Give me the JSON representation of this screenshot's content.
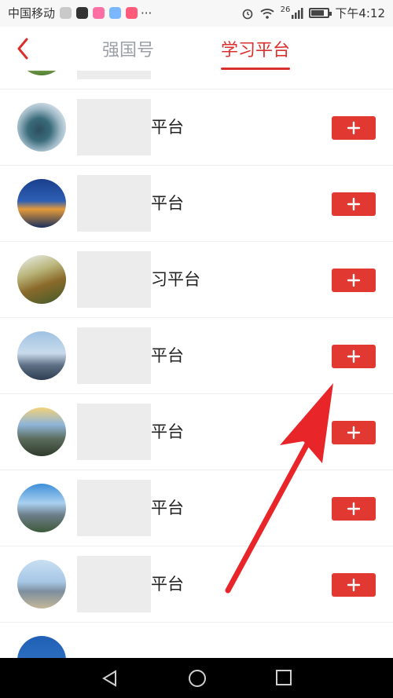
{
  "status": {
    "carrier": "中国移动",
    "signal_label": "26",
    "time": "下午4:12"
  },
  "nav": {
    "tabs": [
      {
        "label": "强国号",
        "active": false
      },
      {
        "label": "学习平台",
        "active": true
      }
    ]
  },
  "list": {
    "items": [
      {
        "name": "平台"
      },
      {
        "name": "平台"
      },
      {
        "name": "习平台"
      },
      {
        "name": "平台"
      },
      {
        "name": "平台"
      },
      {
        "name": "平台"
      },
      {
        "name": "平台"
      }
    ]
  },
  "colors": {
    "accent": "#d9302e",
    "button": "#e23832",
    "annotation_arrow": "#e8262a"
  },
  "icons": {
    "back": "chevron-left-icon",
    "add": "plus-icon",
    "nav_back": "triangle-back-icon",
    "nav_home": "circle-home-icon",
    "nav_recent": "square-recent-icon"
  }
}
